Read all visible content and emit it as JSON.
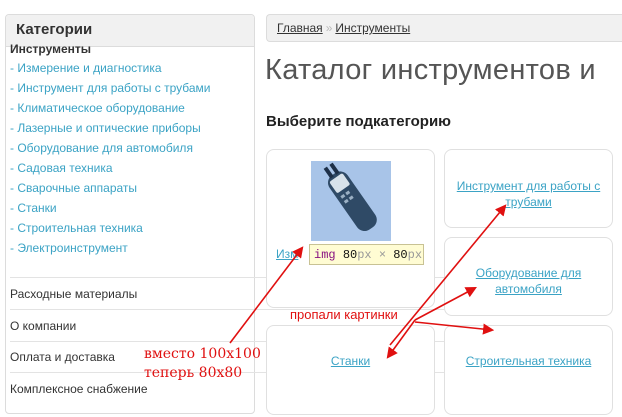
{
  "sidebar": {
    "title": "Категории",
    "current_category": "Инструменты",
    "subcategories": [
      "- Измерение и диагностика",
      "- Инструмент для работы с трубами",
      "- Климатическое оборудование",
      "- Лазерные и оптические приборы",
      "- Оборудование для автомобиля",
      "- Садовая техника",
      "- Сварочные аппараты",
      "- Станки",
      "- Строительная техника",
      "- Электроинструмент"
    ],
    "links": [
      "Расходные материалы",
      "О компании",
      "Оплата и доставка",
      "Комплексное снабжение"
    ]
  },
  "breadcrumb": {
    "home": "Главная",
    "separator": "»",
    "current": "Инструменты"
  },
  "page_title": "Каталог инструментов и",
  "subtitle": "Выберите подкатегорию",
  "cards": {
    "measure_partial": "Изм",
    "pipes": "Инструмент для работы с трубами",
    "auto": "Оборудование для автомобиля",
    "machines": "Станки",
    "construction": "Строительная техника"
  },
  "tooltip": {
    "tag": "img",
    "width": "80",
    "height": "80",
    "unit": "px",
    "times": "×"
  },
  "annotations": {
    "missing_images": "пропали картинки",
    "was_size": "вместо 100x100",
    "now_size": "теперь 80x80"
  },
  "colors": {
    "link": "#3ba3c5",
    "annotation": "#e01010",
    "thumb_bg": "#a8c4e8"
  }
}
